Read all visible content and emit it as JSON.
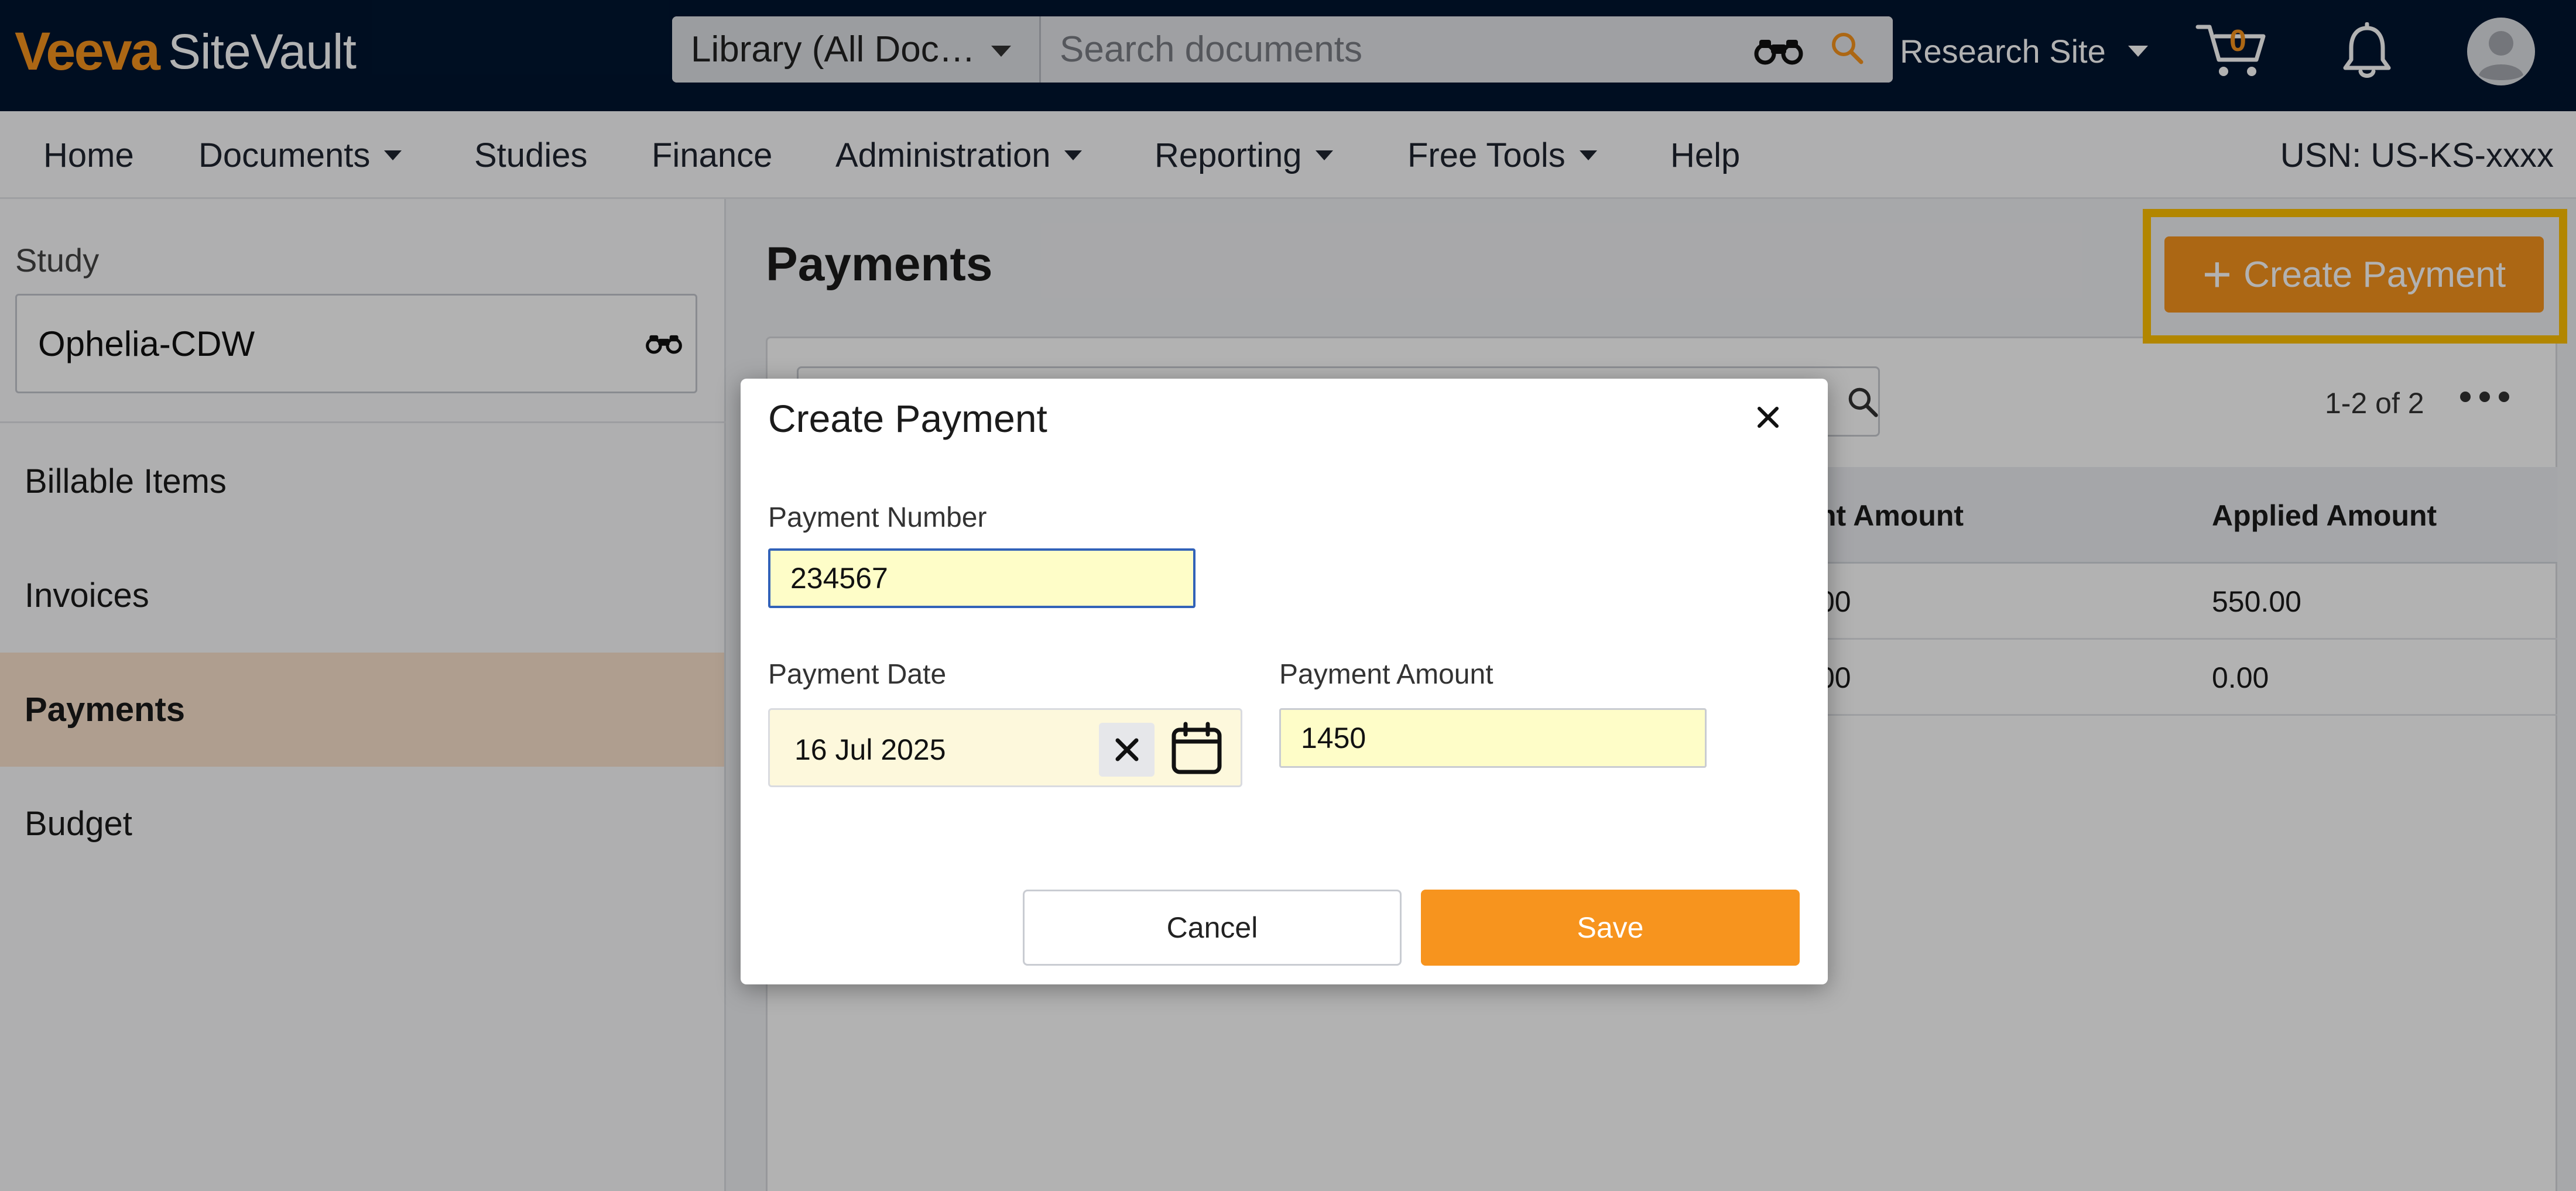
{
  "brand": {
    "logo_primary": "Veeva",
    "logo_secondary": "SiteVault",
    "accent_color": "#f7941e",
    "topbar_color": "#001530"
  },
  "topbar": {
    "library_select": "Library (All Doc…",
    "search_placeholder": "Search documents",
    "site_name": "Research Site",
    "cart_count": "0"
  },
  "nav": {
    "items": [
      {
        "label": "Home",
        "has_menu": false
      },
      {
        "label": "Documents",
        "has_menu": true
      },
      {
        "label": "Studies",
        "has_menu": false
      },
      {
        "label": "Finance",
        "has_menu": false
      },
      {
        "label": "Administration",
        "has_menu": true
      },
      {
        "label": "Reporting",
        "has_menu": true
      },
      {
        "label": "Free Tools",
        "has_menu": true
      },
      {
        "label": "Help",
        "has_menu": false
      }
    ],
    "usn": "USN: US-KS-xxxx"
  },
  "sidebar": {
    "study_label": "Study",
    "study_value": "Ophelia-CDW",
    "items": [
      {
        "label": "Billable Items",
        "active": false
      },
      {
        "label": "Invoices",
        "active": false
      },
      {
        "label": "Payments",
        "active": true
      },
      {
        "label": "Budget",
        "active": false
      }
    ]
  },
  "main": {
    "title": "Payments",
    "create_button": "Create Payment",
    "pager": "1-2 of 2",
    "columns": [
      "nt Amount",
      "Applied Amount"
    ],
    "rows": [
      [
        "00",
        "550.00"
      ],
      [
        "00",
        "0.00"
      ]
    ]
  },
  "modal": {
    "title": "Create Payment",
    "payment_number_label": "Payment Number",
    "payment_number_value": "234567",
    "payment_date_label": "Payment Date",
    "payment_date_value": "16 Jul 2025",
    "payment_amount_label": "Payment Amount",
    "payment_amount_value": "1450",
    "cancel_label": "Cancel",
    "save_label": "Save"
  }
}
